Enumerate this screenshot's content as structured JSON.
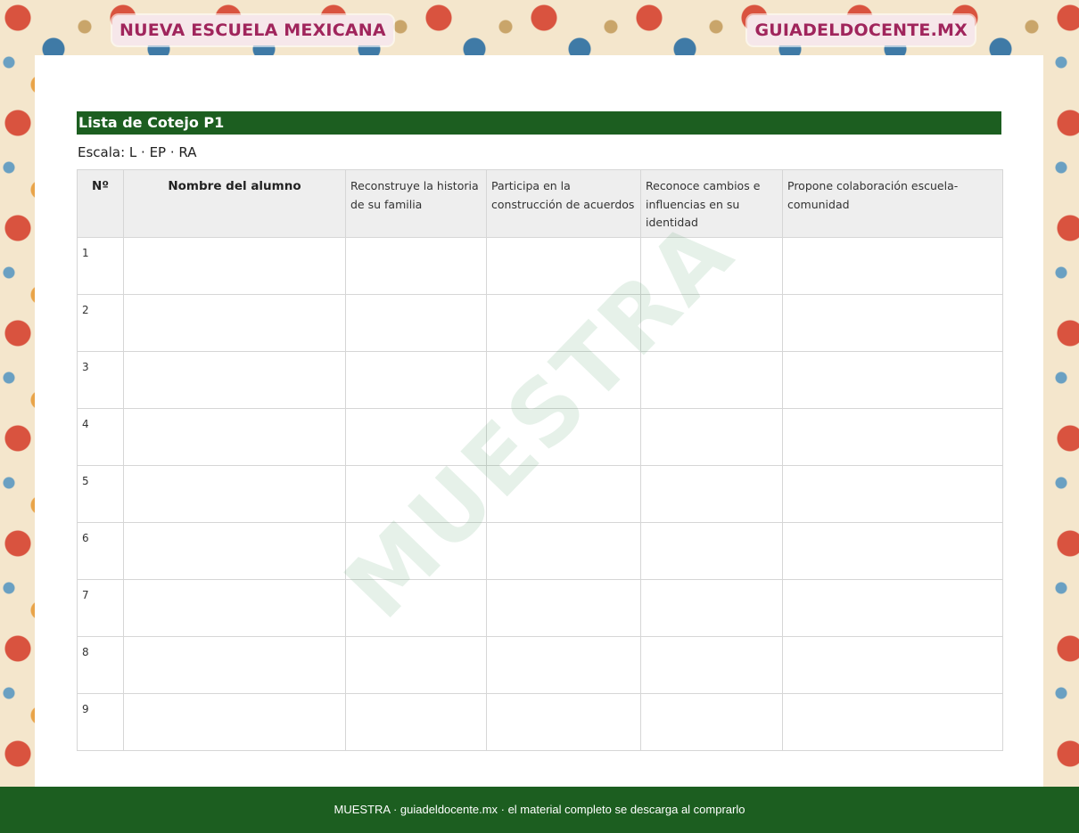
{
  "banner": {
    "left_label": "NUEVA ESCUELA MEXICANA",
    "right_label": "GUIADELDOCENTE.MX"
  },
  "document": {
    "title": "Lista de Cotejo P1",
    "scale": "Escala: L · EP · RA"
  },
  "table": {
    "headers": [
      "Nº",
      "Nombre del alumno",
      "Reconstruye la historia de su familia",
      "Participa en la construcción de acuerdos",
      "Reconoce cambios e influencias en su identidad",
      "Propone colaboración escuela-comunidad"
    ],
    "rows": [
      "1",
      "2",
      "3",
      "4",
      "5",
      "6",
      "7",
      "8",
      "9"
    ]
  },
  "watermark": "MUESTRA",
  "footer": "MUESTRA · guiadeldocente.mx · el material completo se descarga al comprarlo",
  "colors": {
    "accent_green": "#1c5e20",
    "banner_text": "#a0255c",
    "banner_pill": "#f6e7ea"
  }
}
